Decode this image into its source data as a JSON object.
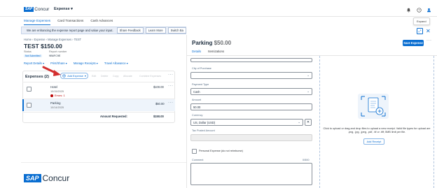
{
  "header": {
    "brand_sap": "SAP",
    "brand_concur": "Concur",
    "app_menu": "Expense ▾",
    "subnav": [
      "Manage Expenses",
      "Card Transactions",
      "Cash Advances"
    ],
    "tooltip": "Expand"
  },
  "banner": {
    "text": "We are enhancing the expense report page and value your input.",
    "buttons": [
      "Share Feedback",
      "Learn More",
      "Switch Ba"
    ]
  },
  "report": {
    "breadcrumb": "Home › Expense › Manage Expenses › TEST",
    "title": "TEST $150.00",
    "status_label": "Status",
    "status_value": "Not Submitted",
    "report_number_label": "Report number",
    "report_number_value": "9B6FC9E",
    "actions": [
      "Report Details ▾",
      "Print/Share ▾",
      "Manage Receipts ▾",
      "Travel Allowance ▾"
    ]
  },
  "expenses": {
    "heading": "Expenses (2)",
    "add_label": "Add Expense",
    "toolbar": [
      "Edit",
      "Delete",
      "Copy",
      "Allocate",
      "Combine Expenses"
    ],
    "rows": [
      {
        "name": "Hotel",
        "date": "10/15/2025",
        "amount": "$100.00",
        "error": "Errors: 1"
      },
      {
        "name": "Parking",
        "date": "10/14/2025",
        "amount": "$50.00"
      }
    ],
    "amount_requested_label": "Amount Requested:",
    "amount_requested_value": "$150.00"
  },
  "detail": {
    "title": "Parking",
    "amount": "$50.00",
    "save_label": "Save Expense",
    "tabs": [
      "Details",
      "Itemizations"
    ],
    "fields": {
      "city_label": "City of Purchase",
      "payment_label": "Payment Type",
      "payment_value": "Cash",
      "amount_label": "Amount",
      "amount_value": "50.00",
      "currency_label": "Currency",
      "currency_value": "US, Dollar (USD)",
      "tax_label": "Tax Posted Amount",
      "personal_label": "Personal Expense (do not reimburse)",
      "comment_label": "Comment",
      "comment_counter": "0/500"
    }
  },
  "receipt": {
    "text": "Click to upload or drag and drop files to upload a new receipt. Valid file types for upload are .png, .jpg, .jpeg, .pdf, .tif or .tiff; 5MB limit per file.",
    "add_label": "Add Receipt"
  },
  "footer": {
    "brand_sap": "SAP",
    "brand_concur": "Concur"
  },
  "colors": {
    "accent": "#0a6ed1",
    "error": "#bb0000",
    "arrow": "#d32f2f"
  }
}
